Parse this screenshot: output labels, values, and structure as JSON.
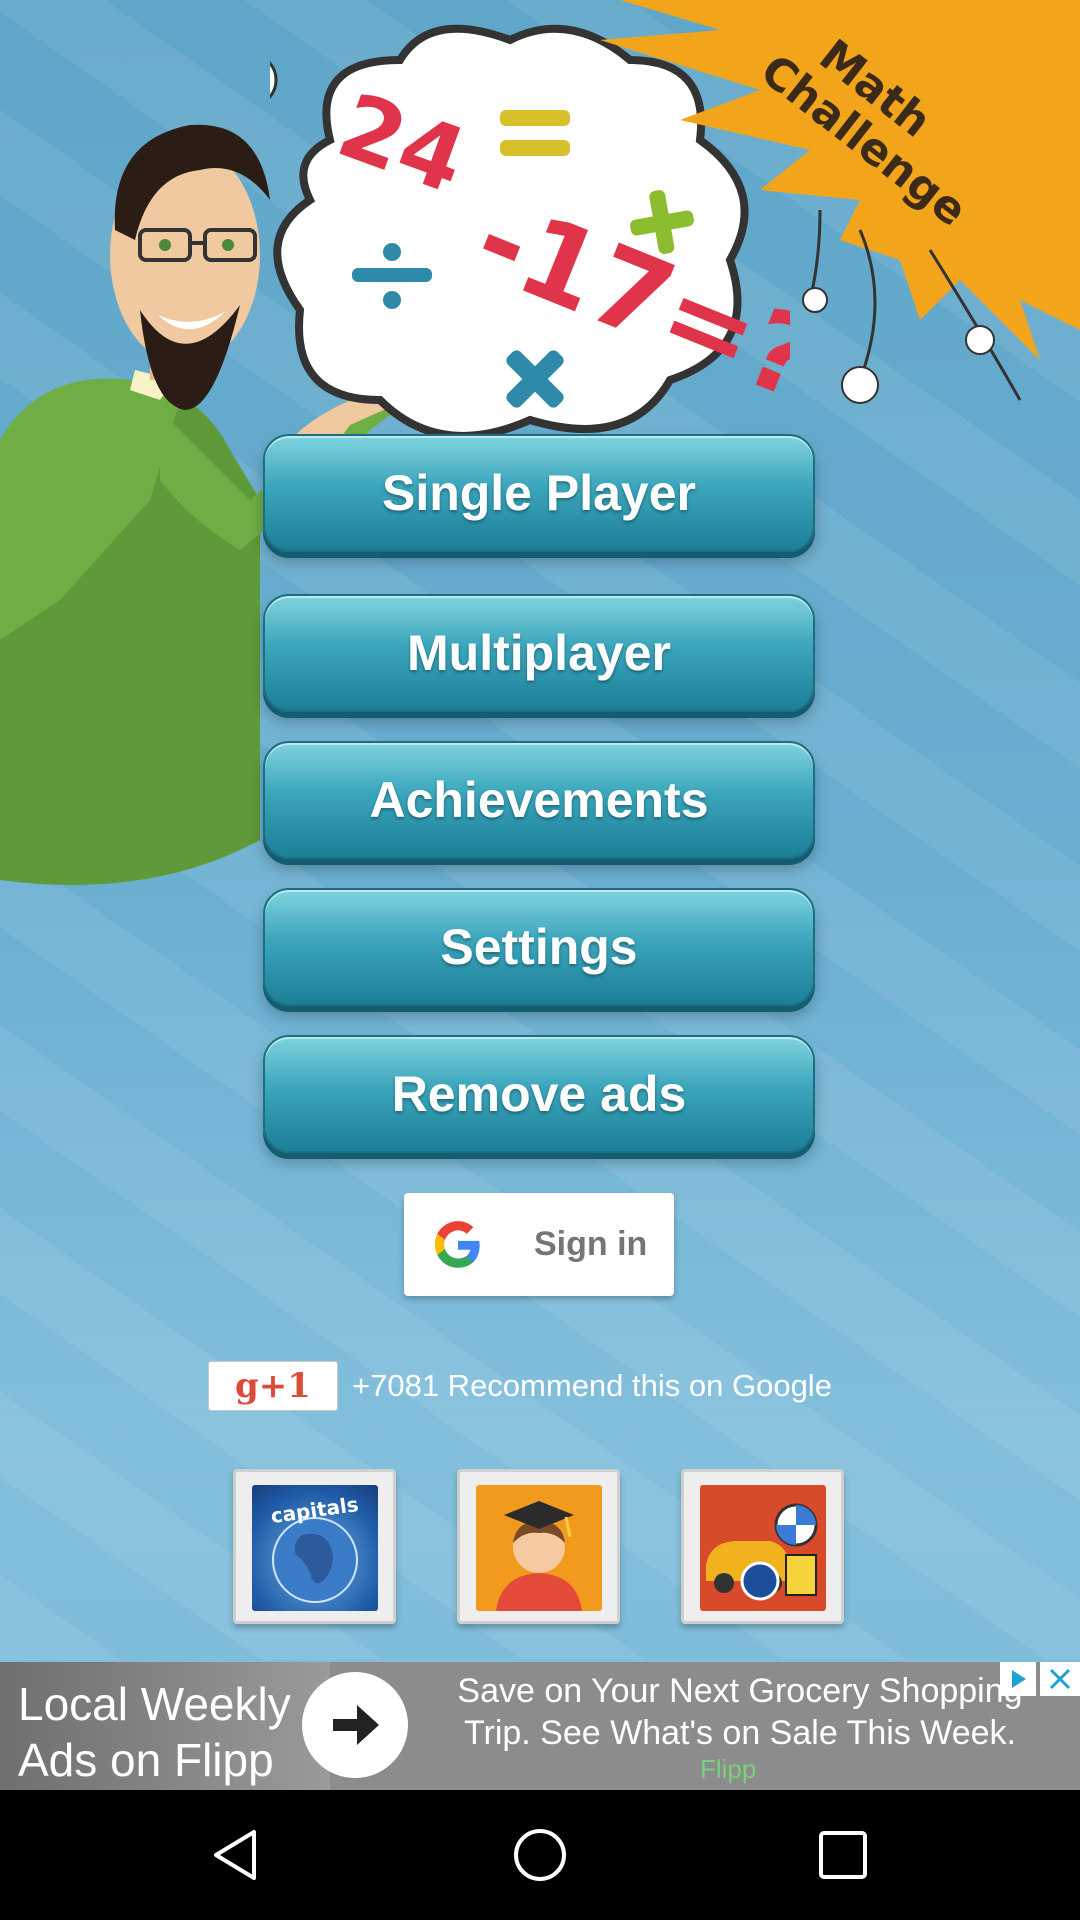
{
  "app": {
    "badge_text": "Math\nChallenge",
    "badge_line1": "Math",
    "badge_line2": "Challenge",
    "equation": [
      "24",
      "-",
      "17",
      "=",
      "?"
    ]
  },
  "menu": {
    "items": [
      {
        "label": "Single Player"
      },
      {
        "label": "Multiplayer"
      },
      {
        "label": "Achievements"
      },
      {
        "label": "Settings"
      },
      {
        "label": "Remove ads"
      }
    ]
  },
  "signin": {
    "label": "Sign in"
  },
  "gplus": {
    "button_label": "g+1",
    "count_text": "+7081 Recommend this on Google"
  },
  "promos": {
    "tiles": [
      {
        "name": "capitals",
        "label": "capitals"
      },
      {
        "name": "graduate"
      },
      {
        "name": "cars"
      }
    ]
  },
  "ad": {
    "title": "Local Weekly Ads on Flipp",
    "text": "Save on Your Next Grocery Shopping Trip. See What's on Sale This Week.",
    "brand": "Flipp"
  },
  "colors": {
    "button_top": "#7fd3de",
    "button_bottom": "#1c7f98",
    "burst": "#f2a51a",
    "background": "#6aaed0"
  }
}
